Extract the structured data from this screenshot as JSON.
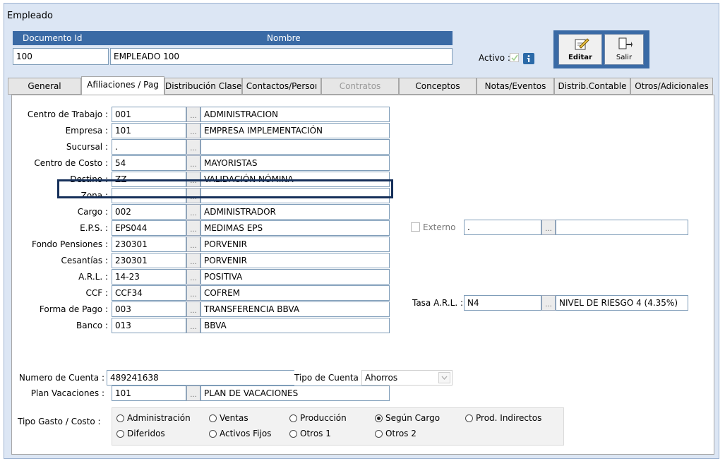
{
  "window": {
    "title": "Empleado"
  },
  "header": {
    "doc_id_label": "Documento Id",
    "name_label": "Nombre",
    "doc_id_value": "100",
    "name_value": "EMPLEADO 100",
    "active_label": "Activo :",
    "active_checked": true,
    "info_icon": "info-icon"
  },
  "toolbar": {
    "edit_label": "Editar",
    "exit_label": "Salir",
    "edit_icon": "edit-document-icon",
    "exit_icon": "exit-door-icon"
  },
  "tabs": [
    {
      "label": "General"
    },
    {
      "label": "Afiliaciones / Pag",
      "active": true
    },
    {
      "label": "Distribución Clase"
    },
    {
      "label": "Contactos/Persoı"
    },
    {
      "label": "Contratos",
      "disabled": true
    },
    {
      "label": "Conceptos"
    },
    {
      "label": "Notas/Eventos"
    },
    {
      "label": "Distrib.Contable"
    },
    {
      "label": "Otros/Adicionales"
    }
  ],
  "fields": [
    {
      "label": "Centro de Trabajo :",
      "code": "001",
      "desc": "ADMINISTRACION"
    },
    {
      "label": "Empresa :",
      "code": "101",
      "desc": "EMPRESA IMPLEMENTACIÓN"
    },
    {
      "label": "Sucursal :",
      "code": ".",
      "desc": ""
    },
    {
      "label": "Centro de Costo :",
      "code": "54",
      "desc": "MAYORISTAS"
    },
    {
      "label": "Destino :",
      "code": "ZZ",
      "desc": "VALIDACIÓN NÓMINA"
    },
    {
      "label": "Zona :",
      "code": ".",
      "desc": ""
    },
    {
      "label": "Cargo :",
      "code": "002",
      "desc": "ADMINISTRADOR"
    },
    {
      "label": "E.P.S. :",
      "code": "EPS044",
      "desc": "MEDIMAS EPS"
    },
    {
      "label": "Fondo Pensiones :",
      "code": "230301",
      "desc": "PORVENIR"
    },
    {
      "label": "Cesantías :",
      "code": "230301",
      "desc": "PORVENIR"
    },
    {
      "label": "A.R.L. :",
      "code": "14-23",
      "desc": "POSITIVA"
    },
    {
      "label": "CCF :",
      "code": "CCF34",
      "desc": "COFREM"
    },
    {
      "label": "Forma de Pago :",
      "code": "003",
      "desc": "TRANSFERENCIA BBVA"
    },
    {
      "label": "Banco :",
      "code": "013",
      "desc": "BBVA"
    }
  ],
  "account": {
    "label": "Numero de Cuenta :",
    "value": "489241638",
    "type_label": "Tipo de Cuenta :",
    "type_value": "Ahorros"
  },
  "vacation": {
    "label": "Plan Vacaciones :",
    "code": "101",
    "desc": "PLAN DE VACACIONES"
  },
  "external": {
    "label": "Externo",
    "checked": false,
    "code": ".",
    "desc": ""
  },
  "arl_rate": {
    "label": "Tasa A.R.L. :",
    "code": "N4",
    "desc": "NIVEL DE RIESGO 4 (4.35%)"
  },
  "expense_type": {
    "label": "Tipo Gasto / Costo :",
    "options": [
      {
        "label": "Administración",
        "selected": false
      },
      {
        "label": "Ventas",
        "selected": false
      },
      {
        "label": "Producción",
        "selected": false
      },
      {
        "label": "Según Cargo",
        "selected": true
      },
      {
        "label": "Prod. Indirectos",
        "selected": false
      },
      {
        "label": "Diferidos",
        "selected": false
      },
      {
        "label": "Activos Fijos",
        "selected": false
      },
      {
        "label": "Otros 1",
        "selected": false
      },
      {
        "label": "Otros 2",
        "selected": false
      }
    ]
  },
  "ellipsis": "...",
  "colors": {
    "header_bar": "#3a6aa5",
    "highlight_border": "#16305a",
    "window_bg": "#dce6f4"
  }
}
